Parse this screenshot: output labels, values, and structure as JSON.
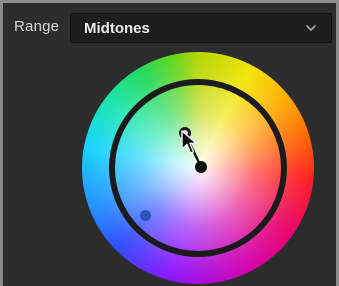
{
  "panel": {
    "range_label": "Range",
    "range_value": "Midtones",
    "dropdown_icon": "chevron-down-icon"
  },
  "colors": {
    "panel_bg": "#2c2c2c",
    "dropdown_bg": "#1d1d1d",
    "ring": "#1b1b1b",
    "shadow_puck": "#2f52b8"
  },
  "icons": {
    "cursor": "arrow-cursor-icon"
  }
}
